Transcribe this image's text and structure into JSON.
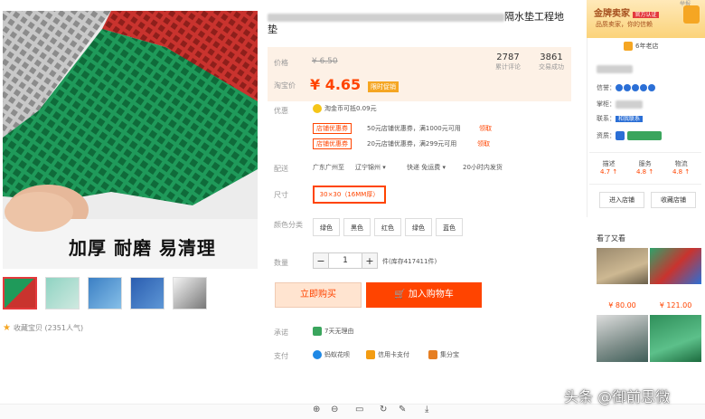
{
  "product": {
    "title_tail": "隔水垫工程地",
    "title_line2": "垫",
    "slogan": "加厚 耐磨 易清理",
    "collect_label": "收藏宝贝 (2351人气)",
    "thumbnail_count": 5
  },
  "price": {
    "price_label": "价格",
    "old_price": "¥ 6.50",
    "promo_label": "淘宝价",
    "new_price": "¥ 4.65",
    "promo_tag": "限时促销",
    "stats": [
      {
        "value": "2787",
        "label": "累计评论"
      },
      {
        "value": "3861",
        "label": "交易成功"
      }
    ]
  },
  "promotions": {
    "label": "优惠",
    "coins_text": "淘金币可抵0.09元",
    "coupons": [
      {
        "tag": "店铺优惠券",
        "text": "50元店铺优惠券，满1000元可用",
        "action": "领取"
      },
      {
        "tag": "店铺优惠券",
        "text": "20元店铺优惠券，满299元可用",
        "action": "领取"
      }
    ]
  },
  "delivery": {
    "label": "配送",
    "from": "广东广州至",
    "to": "辽宁锦州",
    "express": "快递 免运费",
    "time": "20小时内发货"
  },
  "size": {
    "label": "尺寸",
    "selected": "30×30（16MM厚）"
  },
  "colors": {
    "label": "颜色分类",
    "options": [
      "绿色",
      "黑色",
      "红色",
      "绿色",
      "蓝色"
    ]
  },
  "quantity": {
    "label": "数量",
    "minus": "−",
    "value": "1",
    "plus": "+",
    "stock": "件(库存417411件)"
  },
  "actions": {
    "buy_now": "立即购买",
    "cart_icon": "cart-icon",
    "add_to_cart": "加入购物车"
  },
  "services": {
    "promise_label": "承诺",
    "promise_text": "7天无理由",
    "pay_label": "支付",
    "pay_methods": [
      "蚂蚁花呗",
      "信用卡支付",
      "集分宝"
    ]
  },
  "shop": {
    "corner": "举报",
    "gold_title": "金牌卖家",
    "gold_tag": "官方认证",
    "gold_sub": "品质卖家，你的信赖",
    "years": "6年老店",
    "credit_label": "信誉：",
    "keeper_label": "掌柜：",
    "contact_label": "联系：",
    "contact_btn": "和我联系",
    "qual_label": "资质：",
    "scores": [
      {
        "name": "描述",
        "value": "4.7 ↑"
      },
      {
        "name": "服务",
        "value": "4.8 ↑"
      },
      {
        "name": "物流",
        "value": "4.8 ↑"
      }
    ],
    "enter_shop": "进入店铺",
    "fav_shop": "收藏店铺"
  },
  "also_viewed": {
    "title": "看了又看",
    "prices": [
      "¥ 80.00",
      "¥ 121.00"
    ]
  },
  "watermark": "头条 @御前思微",
  "colors_theme": {
    "accent": "#ff4400",
    "promo_bg": "#fdf1e6",
    "gold": "#fbd37a"
  }
}
